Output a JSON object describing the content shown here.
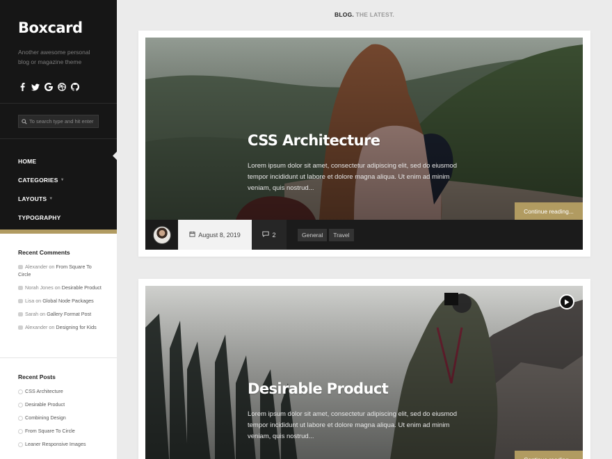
{
  "site": {
    "logo": "Boxcard",
    "tagline": "Another awesome personal blog or magazine theme",
    "socials": [
      "facebook-icon",
      "twitter-icon",
      "google-icon",
      "dribbble-icon",
      "github-icon"
    ],
    "search_placeholder": "To search type and hit enter"
  },
  "nav": [
    {
      "label": "HOME",
      "active": true
    },
    {
      "label": "CATEGORIES",
      "dropdown": true
    },
    {
      "label": "LAYOUTS",
      "dropdown": true
    },
    {
      "label": "TYPOGRAPHY"
    }
  ],
  "recent_comments": {
    "title": "Recent Comments",
    "on_word": "on",
    "items": [
      {
        "author": "Alexander",
        "post": "From Square To Circle"
      },
      {
        "author": "Norah Jones",
        "post": "Desirable Product"
      },
      {
        "author": "Lisa",
        "post": "Global Node Packages"
      },
      {
        "author": "Sarah",
        "post": "Gallery Format Post"
      },
      {
        "author": "Alexander",
        "post": "Designing for Kids"
      }
    ]
  },
  "recent_posts": {
    "title": "Recent Posts",
    "items": [
      "CSS Architecture",
      "Desirable Product",
      "Combining Design",
      "From Square To Circle",
      "Leaner Responsive Images"
    ]
  },
  "blog_head": {
    "part1": "BLOG.",
    "part2": "THE LATEST."
  },
  "posts": [
    {
      "title": "CSS Architecture",
      "excerpt": "Lorem ipsum dolor sit amet, consectetur adipiscing elit, sed do eiusmod tempor incididunt ut labore et dolore magna aliqua. Ut enim ad minim veniam, quis nostrud...",
      "continue": "Continue reading...",
      "date": "August 8, 2019",
      "comments": "2",
      "tags": [
        "General",
        "Travel"
      ]
    },
    {
      "title": "Desirable Product",
      "excerpt": "Lorem ipsum dolor sit amet, consectetur adipiscing elit, sed do eiusmod tempor incididunt ut labore et dolore magna aliqua. Ut enim ad minim veniam, quis nostrud...",
      "continue": "Continue reading...",
      "format_icon": "play-icon"
    }
  ],
  "colors": {
    "accent": "#b19b61",
    "sidebar_dark": "#161616",
    "page_bg": "#ebebeb"
  }
}
